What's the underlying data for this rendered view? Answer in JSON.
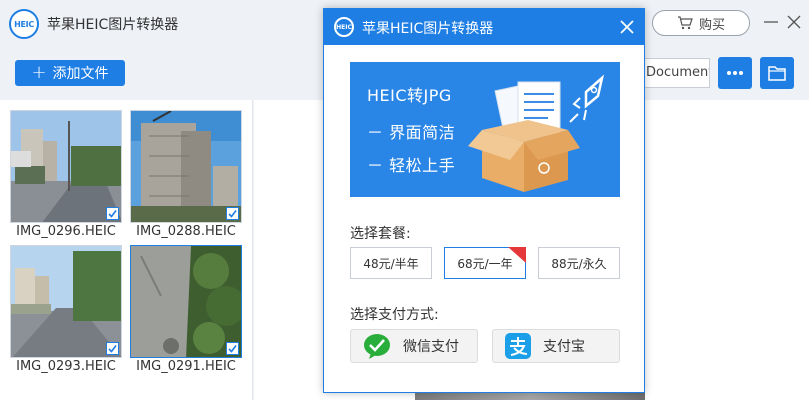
{
  "app": {
    "logo_text": "HEIC",
    "title": "苹果HEIC图片转换器",
    "buy_label": "购买",
    "add_file_label": "添加文件",
    "output_path": "Documents"
  },
  "files": [
    {
      "name": "IMG_0296.HEIC",
      "checked": true
    },
    {
      "name": "IMG_0288.HEIC",
      "checked": true
    },
    {
      "name": "IMG_0293.HEIC",
      "checked": true
    },
    {
      "name": "IMG_0291.HEIC",
      "checked": true
    }
  ],
  "modal": {
    "logo_text": "HEIC",
    "title": "苹果HEIC图片转换器",
    "banner": {
      "line1": "HEIC转JPG",
      "line2": "－ 界面简洁",
      "line3": "－ 轻松上手"
    },
    "plan_label": "选择套餐:",
    "plans": [
      {
        "label": "48元/半年",
        "selected": false
      },
      {
        "label": "68元/一年",
        "selected": true
      },
      {
        "label": "88元/永久",
        "selected": false
      }
    ],
    "pay_label": "选择支付方式:",
    "pay_methods": [
      {
        "label": "微信支付",
        "icon": "wechat-icon"
      },
      {
        "label": "支付宝",
        "icon": "alipay-icon"
      }
    ]
  },
  "colors": {
    "accent": "#1e7ee4",
    "banner": "#2a86e6",
    "wechat": "#2aae3b",
    "alipay": "#1a9fe8",
    "ribbon": "#e5383b"
  }
}
